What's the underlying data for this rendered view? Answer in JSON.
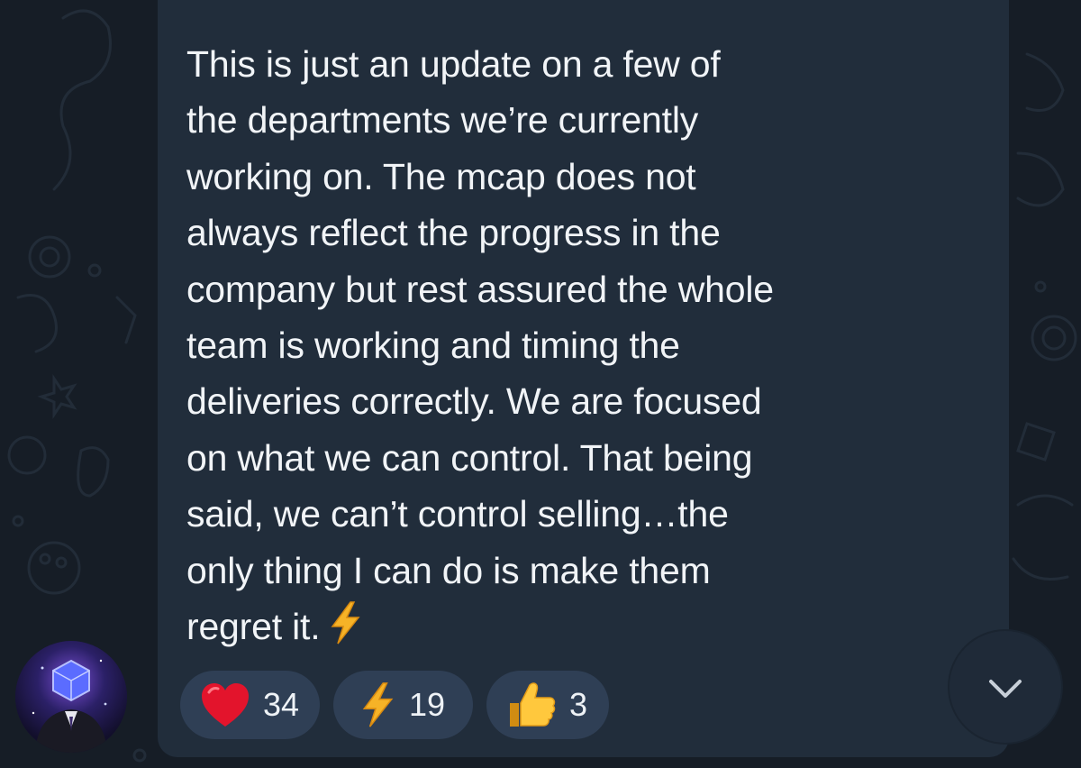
{
  "message": {
    "text": "This is just an update on a few of\nthe departments we’re currently\nworking on. The mcap does not\nalways reflect the progress in the\ncompany but rest assured the whole\nteam is working and timing the\ndeliveries correctly. We are focused\non what we can control. That being\nsaid, we can’t control selling…the\nonly thing I can do is make them\nregret it."
  },
  "reactions": [
    {
      "icon": "red-heart-icon",
      "count": "34"
    },
    {
      "icon": "lightning-icon",
      "count": "19"
    },
    {
      "icon": "thumbs-up-icon",
      "count": "3"
    }
  ],
  "colors": {
    "background": "#161d26",
    "bubble": "#212d3b",
    "chip": "#2f3f55",
    "text": "#f1f4f7"
  }
}
